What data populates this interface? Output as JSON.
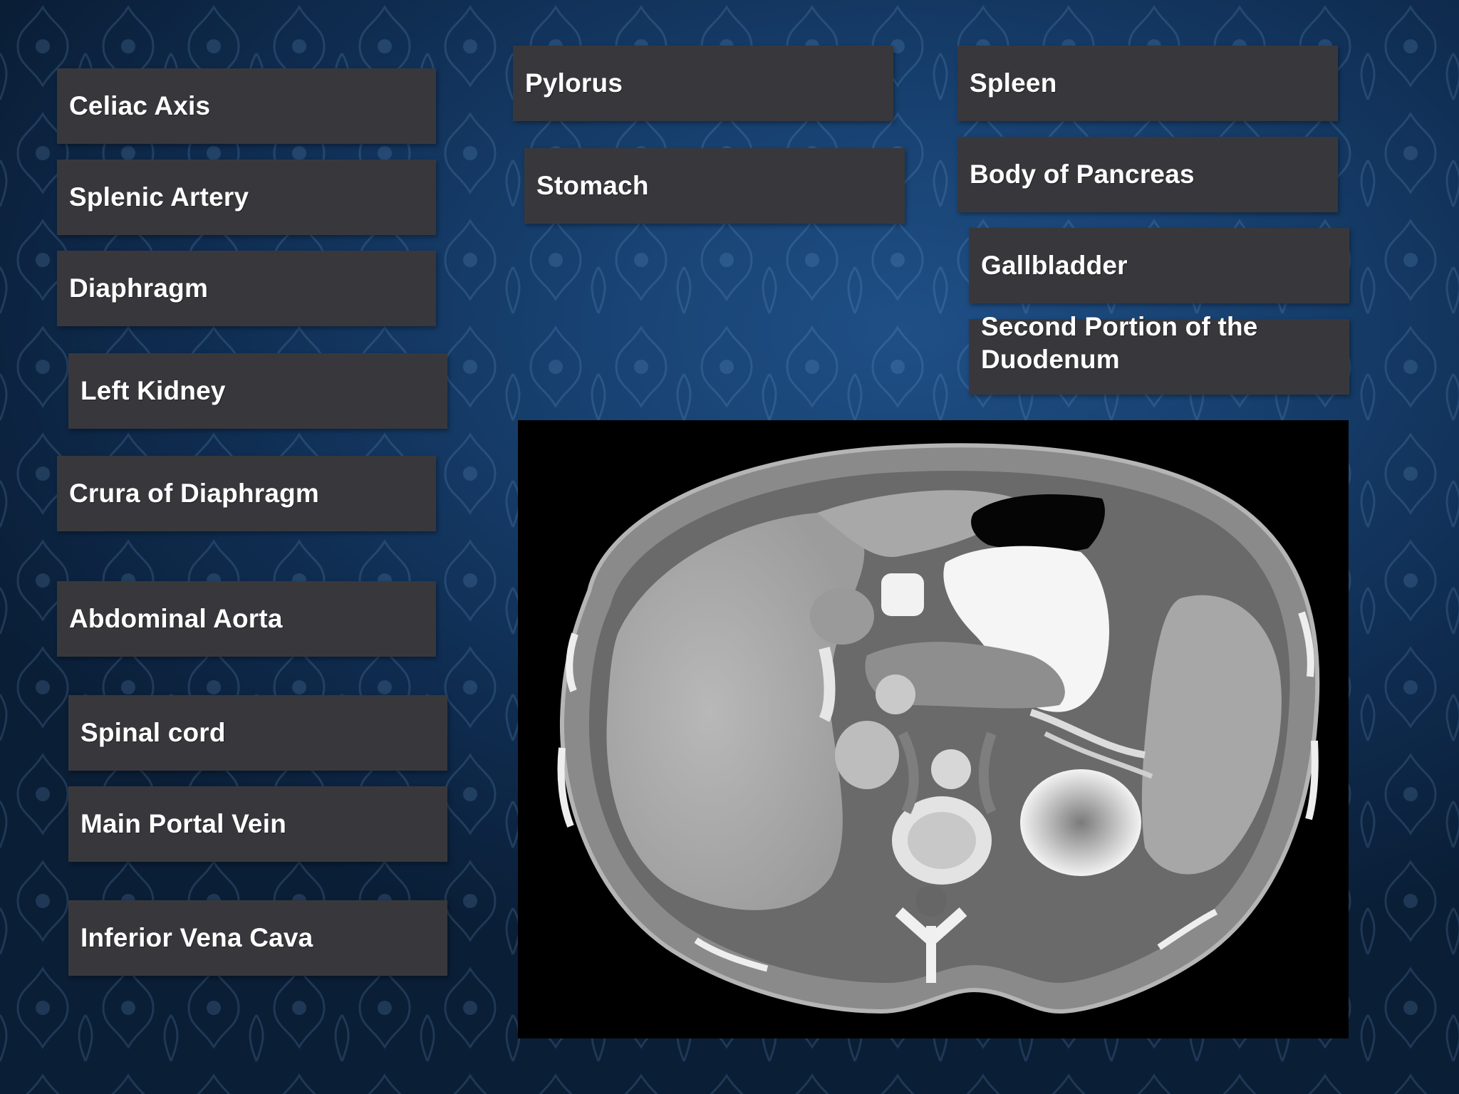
{
  "labels": {
    "celiac_axis": "Celiac Axis",
    "splenic_artery": "Splenic Artery",
    "diaphragm": "Diaphragm",
    "left_kidney": "Left Kidney",
    "crura_of_diaphragm": "Crura of Diaphragm",
    "abdominal_aorta": "Abdominal Aorta",
    "spinal_cord": "Spinal cord",
    "main_portal_vein": "Main Portal Vein",
    "inferior_vena_cava": "Inferior Vena Cava",
    "pylorus": "Pylorus",
    "stomach": "Stomach",
    "spleen": "Spleen",
    "body_of_pancreas": "Body of Pancreas",
    "gallbladder": "Gallbladder",
    "second_portion_duodenum_line1": "Second Portion of the",
    "second_portion_duodenum_line2": "Duodenum"
  },
  "colors": {
    "label_bg": "#38383c",
    "label_text": "#ffffff",
    "background_blue": "#17406f"
  }
}
